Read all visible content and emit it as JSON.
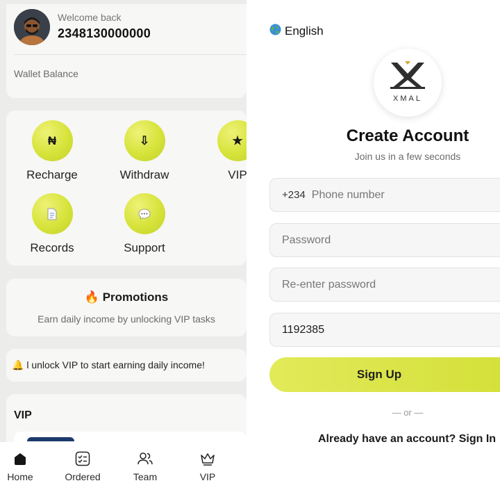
{
  "dashboard": {
    "welcome_text": "Welcome back",
    "phone": "2348130000000",
    "wallet_label": "Wallet Balance",
    "actions": [
      {
        "label": "Recharge",
        "glyph": "₦",
        "icon": "naira-icon"
      },
      {
        "label": "Withdraw",
        "glyph": "⇩",
        "icon": "download-arrow-icon"
      },
      {
        "label": "VIP",
        "glyph": "★",
        "icon": "star-icon"
      },
      {
        "label": "Records",
        "glyph": "📄",
        "icon": "document-icon"
      },
      {
        "label": "Support",
        "glyph": "💬",
        "icon": "chat-icon"
      }
    ],
    "promo": {
      "emoji": "🔥",
      "title": "Promotions",
      "subtitle": "Earn daily income by unlocking VIP tasks"
    },
    "notice": {
      "emoji": "🔔",
      "text": "l unlock VIP to start earning daily income!"
    },
    "vip_heading": "VIP",
    "tabs": [
      {
        "label": "Home",
        "icon": "home-icon",
        "active": true
      },
      {
        "label": "Ordered",
        "icon": "checklist-icon",
        "active": false
      },
      {
        "label": "Team",
        "icon": "team-icon",
        "active": false
      },
      {
        "label": "VIP",
        "icon": "crown-icon",
        "active": false
      }
    ]
  },
  "signup": {
    "language": "English",
    "language_icon": "globe-icon",
    "logo_text": "XMAL",
    "title": "Create Account",
    "subtitle": "Join us in a few seconds",
    "country_code": "+234",
    "phone_placeholder": "Phone number",
    "password_placeholder": "Password",
    "reenter_placeholder": "Re-enter password",
    "invite_code": "1192385",
    "submit_label": "Sign Up",
    "or_text": "— or —",
    "signin_text": "Already have an account? Sign In"
  },
  "colors": {
    "accent": "#d6e33a",
    "panel_bg": "#ececea",
    "card_bg": "#f7f7f5"
  }
}
